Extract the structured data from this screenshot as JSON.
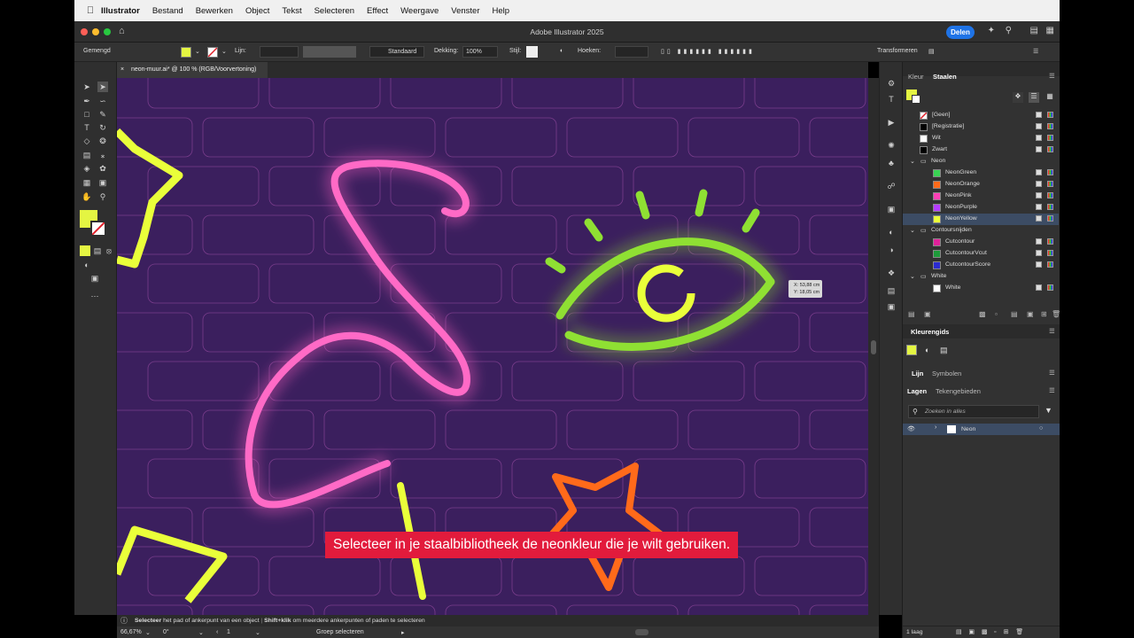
{
  "menubar": {
    "app_name": "Illustrator",
    "items": [
      "Bestand",
      "Bewerken",
      "Object",
      "Tekst",
      "Selecteren",
      "Effect",
      "Weergave",
      "Venster",
      "Help"
    ]
  },
  "titlebar": {
    "title": "Adobe Illustrator 2025",
    "share_label": "Delen"
  },
  "control_bar": {
    "selection_type": "Gemengd",
    "stroke_label": "Lijn:",
    "stroke_profile": "Standaard",
    "opacity_label": "Dekking:",
    "opacity_value": "100%",
    "style_label": "Stijl:",
    "corners_label": "Hoeken:",
    "transform_label": "Transformeren",
    "fill_color": "#e4f542"
  },
  "document_tab": {
    "title": "neon-muur.ai* @ 100 % (RGB/Voorvertoning)"
  },
  "canvas": {
    "background_color": "#3b1f5e",
    "tooltip_x": "X: 53,88 cm",
    "tooltip_y": "Y: 18,05 cm",
    "neon_colors": {
      "pink": "#ff5fbf",
      "green": "#8fe033",
      "yellow": "#eaff3a",
      "orange": "#ff6a1a"
    }
  },
  "subtitle": {
    "text": "Selecteer in je staalbibliotheek de neonkleur die je wilt gebruiken."
  },
  "panels": {
    "top_tabs": [
      "Kleur",
      "Staalen"
    ],
    "swatches": [
      {
        "name": "[Geen]",
        "color": "none",
        "indent": 0
      },
      {
        "name": "[Registratie]",
        "color": "#000000",
        "indent": 0
      },
      {
        "name": "Wit",
        "color": "#ffffff",
        "indent": 0
      },
      {
        "name": "Zwart",
        "color": "#000000",
        "indent": 0
      },
      {
        "name": "Neon",
        "group": true
      },
      {
        "name": "NeonGreen",
        "color": "#39d353",
        "indent": 1
      },
      {
        "name": "NeonOrange",
        "color": "#ff6a1a",
        "indent": 1
      },
      {
        "name": "NeonPink",
        "color": "#ff3fb5",
        "indent": 1
      },
      {
        "name": "NeonPurple",
        "color": "#b43cff",
        "indent": 1
      },
      {
        "name": "NeonYellow",
        "color": "#eaff3a",
        "indent": 1,
        "selected": true
      },
      {
        "name": "Contoursnijden",
        "group": true
      },
      {
        "name": "Cutcontour",
        "color": "#e0219a",
        "indent": 1
      },
      {
        "name": "CutcontourVcut",
        "color": "#1e9a3a",
        "indent": 1
      },
      {
        "name": "CutcontourScore",
        "color": "#2b2bd1",
        "indent": 1
      },
      {
        "name": "White",
        "group": true
      },
      {
        "name": "White",
        "color": "#ffffff",
        "indent": 1
      }
    ],
    "color_guide_title": "Kleurengids",
    "stroke_tabs": [
      "Lijn",
      "Symbolen"
    ],
    "layers_tabs": [
      "Lagen",
      "Tekengebieden"
    ],
    "search_placeholder": "Zoeken in alles",
    "layer_name": "Neon",
    "layer_count": "1 laag"
  },
  "statusbar": {
    "hint_tool": "Selecteer",
    "hint_text": "het pad of ankerpunt van een object",
    "hint_mod": "Shift+klik",
    "hint_text2": "om meerdere ankerpunten of paden te selecteren",
    "zoom": "66,67%",
    "rotation": "0°",
    "artboard": "1",
    "mode": "Groep selecteren"
  }
}
